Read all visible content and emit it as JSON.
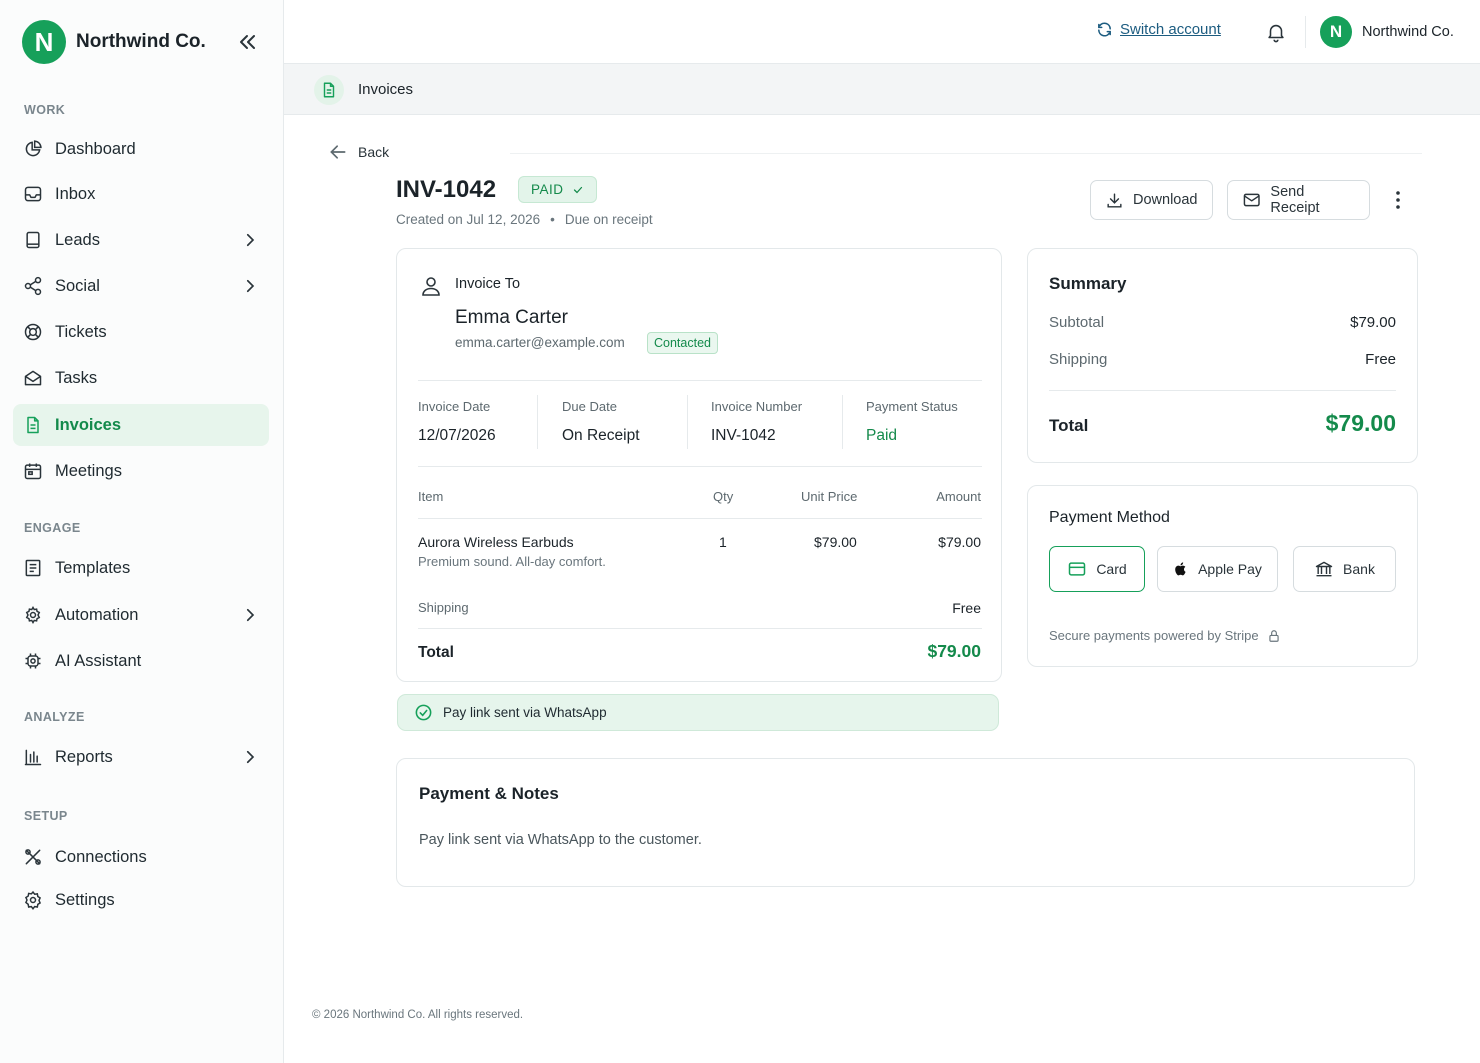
{
  "brand": {
    "name": "Northwind Co.",
    "logo_letter": "N",
    "accent": "#16a05a"
  },
  "sidebar": {
    "sections": [
      {
        "label": "WORK"
      },
      {
        "label": "ENGAGE"
      },
      {
        "label": "ANALYZE"
      },
      {
        "label": "SETUP"
      }
    ],
    "items": [
      {
        "label": "Dashboard",
        "icon": "pie-chart-icon"
      },
      {
        "label": "Inbox",
        "icon": "inbox-icon"
      },
      {
        "label": "Leads",
        "icon": "tablet-icon",
        "has_submenu": true
      },
      {
        "label": "Social",
        "icon": "share-icon",
        "has_submenu": true
      },
      {
        "label": "Tickets",
        "icon": "lifebuoy-icon"
      },
      {
        "label": "Tasks",
        "icon": "envelope-open-icon"
      },
      {
        "label": "Invoices",
        "icon": "document-icon",
        "active": true
      },
      {
        "label": "Meetings",
        "icon": "calendar-icon"
      },
      {
        "label": "Templates",
        "icon": "template-icon"
      },
      {
        "label": "Automation",
        "icon": "gear-icon",
        "has_submenu": true
      },
      {
        "label": "AI Assistant",
        "icon": "chip-icon"
      },
      {
        "label": "Reports",
        "icon": "bar-chart-icon",
        "has_submenu": true
      },
      {
        "label": "Connections",
        "icon": "tools-icon"
      },
      {
        "label": "Settings",
        "icon": "settings-icon"
      }
    ]
  },
  "topbar": {
    "switch_account": "Switch account",
    "account_name": "Northwind Co.",
    "account_initial": "N"
  },
  "breadcrumb": {
    "title": "Invoices"
  },
  "invoice": {
    "back_label": "Back",
    "number": "INV-1042",
    "status_badge": "PAID",
    "created": "Created on Jul 12, 2026",
    "due_note": "Due on receipt",
    "actions": {
      "download": "Download",
      "send_receipt": "Send Receipt"
    },
    "invoice_to_label": "Invoice To",
    "customer": {
      "name": "Emma Carter",
      "email": "emma.carter@example.com",
      "tag": "Contacted"
    },
    "facts": [
      {
        "key": "Invoice Date",
        "value": "12/07/2026"
      },
      {
        "key": "Due Date",
        "value": "On Receipt"
      },
      {
        "key": "Invoice Number",
        "value": "INV-1042"
      },
      {
        "key": "Payment Status",
        "value": "Paid"
      }
    ],
    "table_headers": {
      "item": "Item",
      "qty": "Qty",
      "unit_price": "Unit Price",
      "amount": "Amount"
    },
    "line_items": [
      {
        "name": "Aurora Wireless Earbuds",
        "description": "Premium sound. All-day comfort.",
        "qty": "1",
        "unit_price": "$79.00",
        "amount": "$79.00"
      }
    ],
    "shipping_label": "Shipping",
    "shipping_value": "Free",
    "total_label": "Total",
    "total_value": "$79.00",
    "notice": "Pay link sent via WhatsApp"
  },
  "summary": {
    "title": "Summary",
    "subtotal_label": "Subtotal",
    "subtotal_value": "$79.00",
    "shipping_label": "Shipping",
    "shipping_value": "Free",
    "total_label": "Total",
    "total_value": "$79.00"
  },
  "payment_method": {
    "title": "Payment Method",
    "options": [
      {
        "label": "Card",
        "selected": true
      },
      {
        "label": "Apple Pay"
      },
      {
        "label": "Bank"
      }
    ],
    "secure_text": "Secure payments powered by Stripe"
  },
  "notes": {
    "title": "Payment & Notes",
    "text": "Pay link sent via WhatsApp to the customer."
  },
  "footer": {
    "text": "© 2026 Northwind Co. All rights reserved."
  }
}
